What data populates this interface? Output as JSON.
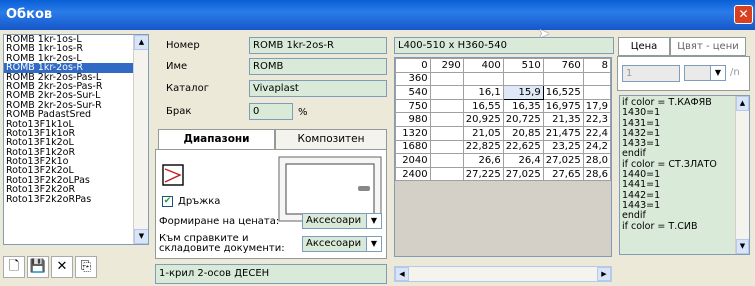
{
  "window": {
    "title": "Обков",
    "close": "✕"
  },
  "list": {
    "items": [
      "ROMB 1kr-1os-L",
      "ROMB 1kr-1os-R",
      "ROMB 1kr-2os-L",
      "ROMB 1kr-2os-R",
      "ROMB 2kr-2os-Pas-L",
      "ROMB 2kr-2os-Pas-R",
      "ROMB 2kr-2os-Sur-L",
      "ROMB 2kr-2os-Sur-R",
      "ROMB PadastSred",
      "Roto13F1k1oL",
      "Roto13F1k1oR",
      "Roto13F1k2oL",
      "Roto13F1k2oR",
      "Roto13F2k1o",
      "Roto13F2k2oL",
      "Roto13F2k2oLPas",
      "Roto13F2k2oR",
      "Roto13F2k2oRPas"
    ],
    "selected_index": 3
  },
  "toolbar": {
    "new": "🗋",
    "save": "💾",
    "delete": "✕",
    "export": "⎘"
  },
  "form": {
    "number_label": "Номер",
    "number_value": "ROMB 1kr-2os-R",
    "name_label": "Име",
    "name_value": "ROMB",
    "catalog_label": "Каталог",
    "catalog_value": "Vivaplast",
    "scrap_label": "Брак",
    "scrap_value": "0",
    "scrap_unit": "%"
  },
  "tabs": {
    "ranges": "Диапазони",
    "composite": "Композитен"
  },
  "panel": {
    "handle_label": "Дръжка",
    "handle_checked": true,
    "pricing_label": "Формиране на цената:",
    "pricing_value": "Аксесоари",
    "reports_label_1": "Към справките и",
    "reports_label_2": "складовите документи:",
    "reports_value": "Аксесоари"
  },
  "description": "1-крил 2-осов ДЕСЕН",
  "grid": {
    "header": "L400-510 x H360-540",
    "columns": [
      "0",
      "290",
      "400",
      "510",
      "760",
      "8"
    ],
    "rows": [
      [
        "360",
        "",
        "",
        "",
        "",
        ""
      ],
      [
        "540",
        "",
        "16,1",
        "15,9",
        "16,525",
        ""
      ],
      [
        "750",
        "",
        "16,55",
        "16,35",
        "16,975",
        "17,9"
      ],
      [
        "980",
        "",
        "20,925",
        "20,725",
        "21,35",
        "22,3"
      ],
      [
        "1320",
        "",
        "21,05",
        "20,85",
        "21,475",
        "22,4"
      ],
      [
        "1680",
        "",
        "22,825",
        "22,625",
        "23,25",
        "24,2"
      ],
      [
        "2040",
        "",
        "26,6",
        "26,4",
        "27,025",
        "28,0"
      ],
      [
        "2400",
        "",
        "27,225",
        "27,025",
        "27,65",
        "28,6"
      ]
    ]
  },
  "right": {
    "tab_price": "Цена",
    "tab_color_prices": "Цвят - цени",
    "field_value": "1",
    "unit": "/n",
    "code": [
      "if color = Т.КАФЯВ",
      "1430=1",
      "1431=1",
      "1432=1",
      "1433=1",
      "endif",
      "if color = СТ.ЗЛАТО",
      "1440=1",
      "1441=1",
      "1442=1",
      "1443=1",
      "endif",
      "if color = Т.СИВ"
    ]
  }
}
